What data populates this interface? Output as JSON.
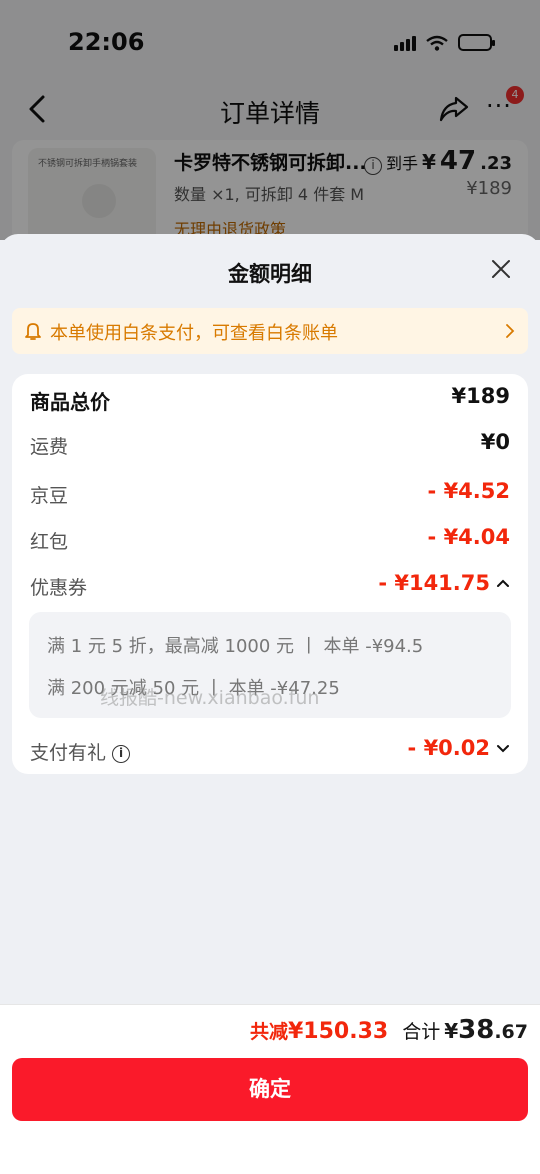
{
  "status_bar": {
    "time": "22:06"
  },
  "nav": {
    "title": "订单详情",
    "more_badge": "4"
  },
  "product": {
    "thumb_label": "不锈钢可拆卸手柄锅套装",
    "name": "卡罗特不锈钢可拆卸...",
    "spec": "数量 ×1, 可拆卸 4 件套 M",
    "policy": "无理由退货政策",
    "price_prefix": "到手",
    "price_yen": "¥",
    "price_int": "47",
    "price_dec": ".23",
    "original_price": "¥189"
  },
  "sheet": {
    "title": "金额明细",
    "notice": "本单使用白条支付，可查看白条账单",
    "rows": [
      {
        "label": "商品总价",
        "value": "¥189"
      },
      {
        "label": "运费",
        "value": "¥0"
      },
      {
        "label": "京豆",
        "value": "- ¥4.52"
      },
      {
        "label": "红包",
        "value": "- ¥4.04"
      },
      {
        "label": "优惠券",
        "value": "- ¥141.75"
      },
      {
        "label": "支付有礼",
        "value": "- ¥0.02"
      }
    ],
    "coupons": [
      "满 1 元 5 折，最高减 1000 元  丨 本单 -¥94.5",
      "满 200 元减 50 元  丨 本单 -¥47.25"
    ],
    "watermark": "线报酷-new.xianbao.fun"
  },
  "footer": {
    "reduce_label": "共减",
    "reduce_amount": "¥150.33",
    "total_label": "合计",
    "total_yen": "¥",
    "total_int": "38",
    "total_dec": ".67",
    "confirm_label": "确定"
  },
  "colors": {
    "accent_red": "#f2270c",
    "button_red": "#fa1a2a",
    "notice_orange": "#d87a00",
    "notice_bg": "#fff5e4"
  }
}
